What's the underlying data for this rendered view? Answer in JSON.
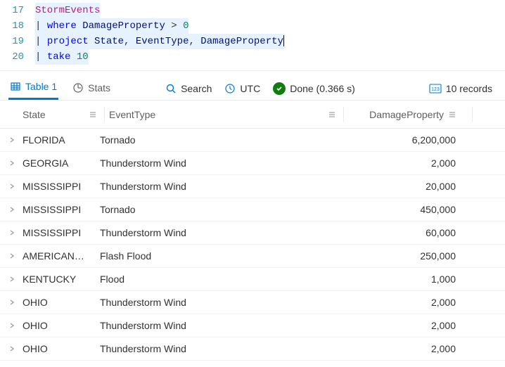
{
  "editor": {
    "lines": [
      {
        "num": "17",
        "tokens": [
          {
            "cls": "tk-table",
            "t": "StormEvents"
          }
        ],
        "hl": true
      },
      {
        "num": "18",
        "tokens": [
          {
            "cls": "",
            "t": "| "
          },
          {
            "cls": "tk-keyword",
            "t": "where"
          },
          {
            "cls": "",
            "t": " "
          },
          {
            "cls": "tk-col",
            "t": "DamageProperty"
          },
          {
            "cls": "",
            "t": " > "
          },
          {
            "cls": "tk-num",
            "t": "0"
          }
        ],
        "hl": true
      },
      {
        "num": "19",
        "tokens": [
          {
            "cls": "",
            "t": "| "
          },
          {
            "cls": "tk-keyword",
            "t": "project"
          },
          {
            "cls": "",
            "t": " "
          },
          {
            "cls": "tk-col",
            "t": "State"
          },
          {
            "cls": "",
            "t": ", "
          },
          {
            "cls": "tk-col",
            "t": "EventType"
          },
          {
            "cls": "",
            "t": ", "
          },
          {
            "cls": "tk-col",
            "t": "DamageProperty"
          }
        ],
        "hl": true,
        "cursor": true
      },
      {
        "num": "20",
        "tokens": [
          {
            "cls": "",
            "t": "| "
          },
          {
            "cls": "tk-keyword",
            "t": "take"
          },
          {
            "cls": "",
            "t": " "
          },
          {
            "cls": "tk-num",
            "t": "10"
          }
        ],
        "hl": true
      }
    ]
  },
  "toolbar": {
    "tab_table": "Table 1",
    "tab_stats": "Stats",
    "search": "Search",
    "utc": "UTC",
    "done": "Done (0.366 s)",
    "records": "10 records"
  },
  "grid": {
    "columns": {
      "state": "State",
      "event": "EventType",
      "damage": "DamageProperty"
    },
    "rows": [
      {
        "state": "FLORIDA",
        "event": "Tornado",
        "damage": "6,200,000"
      },
      {
        "state": "GEORGIA",
        "event": "Thunderstorm Wind",
        "damage": "2,000"
      },
      {
        "state": "MISSISSIPPI",
        "event": "Thunderstorm Wind",
        "damage": "20,000"
      },
      {
        "state": "MISSISSIPPI",
        "event": "Tornado",
        "damage": "450,000"
      },
      {
        "state": "MISSISSIPPI",
        "event": "Thunderstorm Wind",
        "damage": "60,000"
      },
      {
        "state": "AMERICAN…",
        "event": "Flash Flood",
        "damage": "250,000"
      },
      {
        "state": "KENTUCKY",
        "event": "Flood",
        "damage": "1,000"
      },
      {
        "state": "OHIO",
        "event": "Thunderstorm Wind",
        "damage": "2,000"
      },
      {
        "state": "OHIO",
        "event": "Thunderstorm Wind",
        "damage": "2,000"
      },
      {
        "state": "OHIO",
        "event": "Thunderstorm Wind",
        "damage": "2,000"
      }
    ]
  }
}
